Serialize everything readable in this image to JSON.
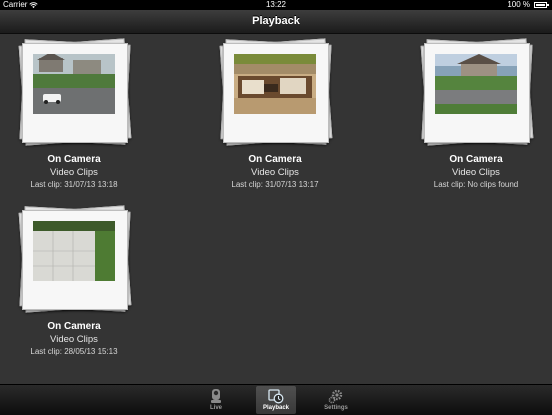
{
  "status_bar": {
    "carrier": "Carrier",
    "time": "13:22",
    "battery": "100 %"
  },
  "nav": {
    "title": "Playback"
  },
  "cameras": [
    {
      "title": "On Camera",
      "subtitle": "Video Clips",
      "last_clip": "Last clip: 31/07/13 13:18"
    },
    {
      "title": "On Camera",
      "subtitle": "Video Clips",
      "last_clip": "Last clip: 31/07/13 13:17"
    },
    {
      "title": "On Camera",
      "subtitle": "Video Clips",
      "last_clip": "Last clip: No clips found"
    },
    {
      "title": "On Camera",
      "subtitle": "Video Clips",
      "last_clip": "Last clip: 28/05/13 15:13"
    }
  ],
  "tabs": [
    {
      "label": "Live",
      "icon": "camera-icon"
    },
    {
      "label": "Playback",
      "icon": "playback-icon",
      "active": true
    },
    {
      "label": "Settings",
      "icon": "gear-icon"
    }
  ],
  "colors": {
    "background": "#343434",
    "navbar": "#1b1b1b",
    "tab_active": "#5a5a5a"
  }
}
